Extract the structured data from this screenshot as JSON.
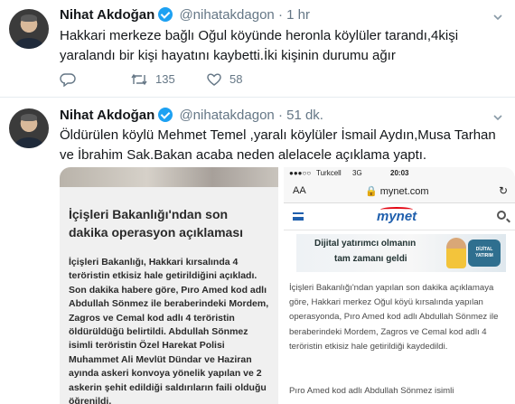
{
  "tweets": [
    {
      "name": "Nihat Akdoğan",
      "handle": "@nihatakdagon",
      "dot": "·",
      "time": "1 hr",
      "text": "Hakkari merkeze bağlı Oğul köyünde heronla köylüler tarandı,4kişi yaralandı bir kişi hayatını kaybetti.İki kişinin durumu ağır",
      "retweets": "135",
      "likes": "58"
    },
    {
      "name": "Nihat Akdoğan",
      "handle": "@nihatakdagon",
      "dot": "·",
      "time": "51 dk.",
      "text": "Öldürülen köylü Mehmet Temel ,yaralı köylüler İsmail Aydın,Musa Tarhan ve İbrahim Sak.Bakan acaba neden alelacele açıklama yaptı."
    }
  ],
  "image_left": {
    "title": "İçişleri Bakanlığı'ndan son dakika operasyon açıklaması",
    "body": "İçişleri Bakanlığı, Hakkari kırsalında 4 teröristin etkisiz hale getirildiğini açıkladı. Son dakika habere göre, Pıro Amed kod adlı Abdullah Sönmez ile beraberindeki Mordem, Zagros ve Cemal kod adlı 4 teröristin öldürüldüğü belirtildi. Abdullah Sönmez isimli teröristin Özel Harekat Polisi Muhammet Ali Mevlüt Dündar ve Haziran ayında askeri konvoya yönelik yapılan ve 2 askerin şehit edildiği saldırıların faili olduğu öğrenildi."
  },
  "image_right": {
    "carrier": "Turkcell",
    "network": "3G",
    "clock": "20:03",
    "aa_label": "AA",
    "url": "mynet.com",
    "logo": "mynet",
    "ad_line1": "Dijital yatırımcı olmanın",
    "ad_line2": "tam zamanı geldi",
    "ad_badge": "DİJİTAL YATIRIM",
    "paragraph1": "İçişleri Bakanlığı'ndan yapılan son dakika açıklamaya göre, Hakkari merkez Oğul köyü kırsalında yapılan operasyonda, Pıro Amed kod adlı Abdullah Sönmez ile beraberindeki Mordem, Zagros ve Cemal kod adlı 4 teröristin etkisiz hale getirildiği kaydedildi.",
    "paragraph2": "Pıro Amed kod adlı Abdullah Sönmez isimli"
  },
  "colors": {
    "link_blue": "#1da1f2",
    "muted_text": "#657786",
    "mynet_blue": "#1f5fad",
    "mynet_red": "#e30613"
  },
  "icons": [
    "verified-icon",
    "reply-icon",
    "retweet-icon",
    "like-icon",
    "chevron-down-icon",
    "menu-icon",
    "search-icon",
    "lock-icon",
    "reload-icon"
  ]
}
